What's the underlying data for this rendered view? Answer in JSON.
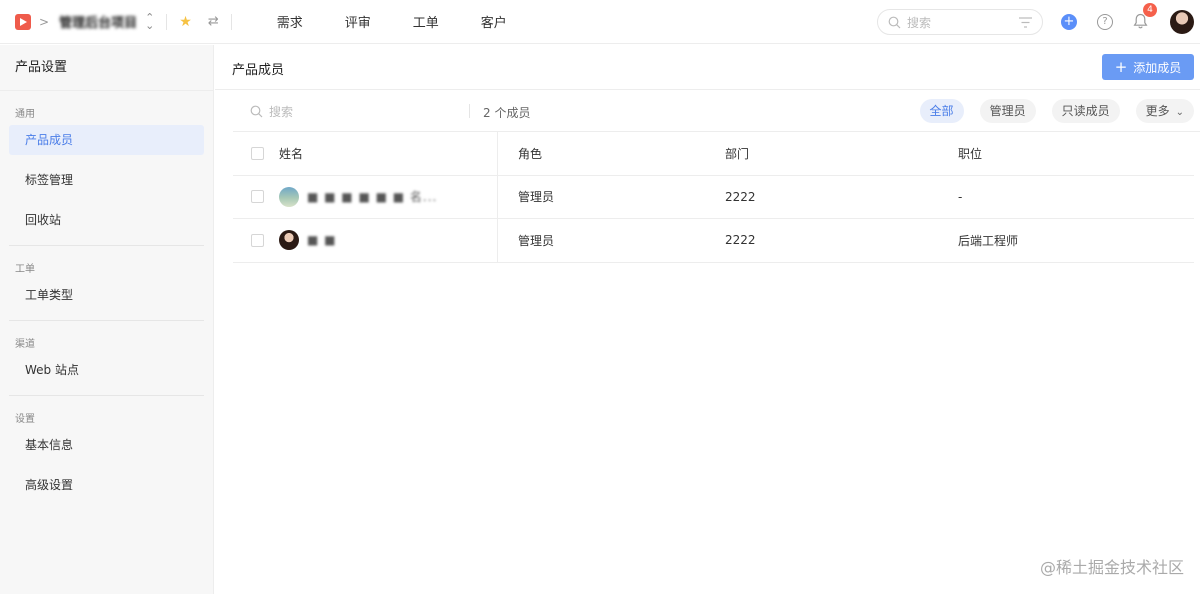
{
  "topbar": {
    "product_name": "管理后台项目",
    "nav": [
      "需求",
      "评审",
      "工单",
      "客户"
    ],
    "search_placeholder": "搜索",
    "notification_count": "4"
  },
  "sidebar": {
    "title": "产品设置",
    "groups": [
      {
        "label": "通用",
        "items": [
          "产品成员",
          "标签管理",
          "回收站"
        ]
      },
      {
        "label": "工单",
        "items": [
          "工单类型"
        ]
      },
      {
        "label": "渠道",
        "items": [
          "Web 站点"
        ]
      },
      {
        "label": "设置",
        "items": [
          "基本信息",
          "高级设置"
        ]
      }
    ]
  },
  "main": {
    "title": "产品成员",
    "add_button": "添加成员",
    "search_placeholder": "搜索",
    "member_count": "2 个成员",
    "filters": [
      "全部",
      "管理员",
      "只读成员",
      "更多"
    ],
    "columns": [
      "姓名",
      "角色",
      "部门",
      "职位"
    ],
    "rows": [
      {
        "name": "■ ■ ■ ■ ■ ■ 名...",
        "role": "管理员",
        "dept": "2222",
        "position": "-"
      },
      {
        "name": "■ ■",
        "role": "管理员",
        "dept": "2222",
        "position": "后端工程师"
      }
    ]
  },
  "watermark": "@稀土掘金技术社区",
  "colors": {
    "accent": "#4a7de8",
    "button": "#6a9bf4",
    "badge": "#f5604b",
    "logo": "#ef5b4b"
  }
}
